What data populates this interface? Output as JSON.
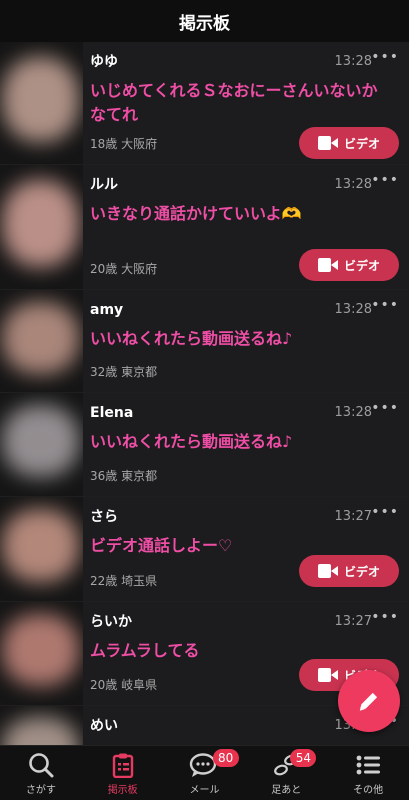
{
  "header": {
    "title": "掲示板"
  },
  "posts": [
    {
      "name": "ゆゆ",
      "time": "13:28",
      "message": "いじめてくれるＳなおにーさんいないかなてれ",
      "meta": "18歳 大阪府",
      "video": true,
      "video_label": "ビデオ",
      "thumb_color": "#c9a79a"
    },
    {
      "name": "ルル",
      "time": "13:28",
      "message": "いきなり通話かけていいよ🫶",
      "meta": "20歳 大阪府",
      "video": true,
      "video_label": "ビデオ",
      "thumb_color": "#d7a59b"
    },
    {
      "name": "amy",
      "time": "13:28",
      "message": "いいねくれたら動画送るね♪",
      "meta": "32歳 東京都",
      "video": false,
      "thumb_color": "#c49a8c"
    },
    {
      "name": "Elena",
      "time": "13:28",
      "message": "いいねくれたら動画送るね♪",
      "meta": "36歳 東京都",
      "video": false,
      "thumb_color": "#a9a3a6"
    },
    {
      "name": "さら",
      "time": "13:27",
      "message": "ビデオ通話しよー♡",
      "meta": "22歳 埼玉県",
      "video": true,
      "video_label": "ビデオ",
      "thumb_color": "#cf9c8c"
    },
    {
      "name": "らいか",
      "time": "13:27",
      "message": "ムラムラしてる",
      "meta": "20歳 岐阜県",
      "video": true,
      "video_label": "ビデオ",
      "thumb_color": "#c98a7f"
    },
    {
      "name": "めい",
      "time": "13:27",
      "message": "",
      "meta": "",
      "video": false,
      "thumb_color": "#b9a59b"
    }
  ],
  "tabs": [
    {
      "id": "search",
      "label": "さがす",
      "icon": "search-icon",
      "badge": ""
    },
    {
      "id": "board",
      "label": "掲示板",
      "icon": "clipboard-icon",
      "badge": "",
      "active": true
    },
    {
      "id": "mail",
      "label": "メール",
      "icon": "chat-bubble-icon",
      "badge": "80"
    },
    {
      "id": "footprints",
      "label": "足あと",
      "icon": "footprints-icon",
      "badge": "54"
    },
    {
      "id": "other",
      "label": "その他",
      "icon": "list-icon",
      "badge": ""
    }
  ],
  "colors": {
    "accent": "#ee4ea5",
    "video_button": "#c93350",
    "fab": "#ee3a5f",
    "badge": "#e8334f",
    "active_tab": "#e53a61"
  }
}
